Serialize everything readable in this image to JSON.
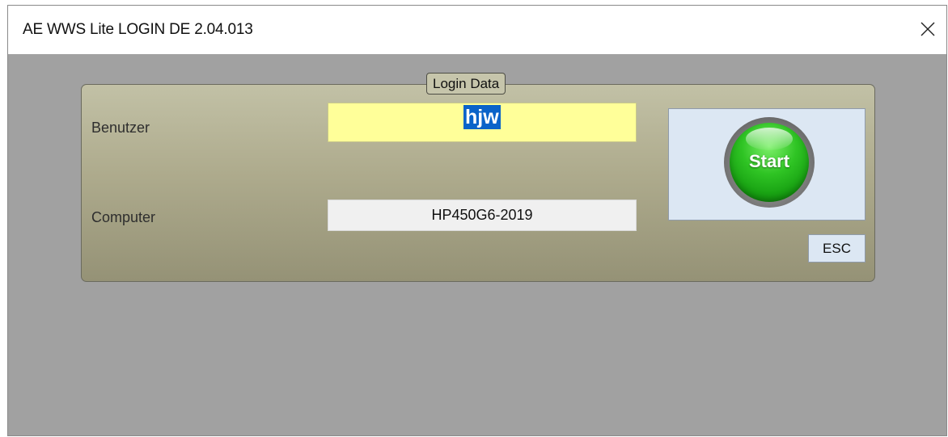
{
  "window": {
    "title": "AE WWS Lite LOGIN DE 2.04.013",
    "close_glyph": "×"
  },
  "login_group": {
    "legend": "Login Data",
    "user_label": "Benutzer",
    "user_value": "hjw",
    "computer_label": "Computer",
    "computer_value": "HP450G6-2019",
    "start_label": "Start",
    "esc_label": "ESC"
  },
  "colors": {
    "user_field_bg": "#ffff99",
    "selection": "#0a63c9",
    "start_green": "#2fc424",
    "client_bg": "#a1a1a1"
  },
  "icons": {
    "close": "close-icon",
    "start": "start-orb-icon"
  }
}
